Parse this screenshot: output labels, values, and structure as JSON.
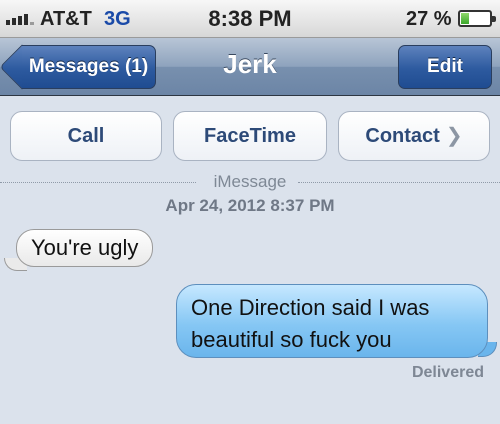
{
  "status_bar": {
    "carrier": "AT&T",
    "network": "3G",
    "time": "8:38 PM",
    "battery_percent": "27 %",
    "battery_level": 0.27,
    "signal_bars": 4
  },
  "nav": {
    "back_label": "Messages (1)",
    "title": "Jerk",
    "edit_label": "Edit"
  },
  "actions": {
    "call": "Call",
    "facetime": "FaceTime",
    "contact": "Contact"
  },
  "conversation": {
    "service_label": "iMessage",
    "timestamp": "Apr 24, 2012 8:37 PM",
    "messages": [
      {
        "direction": "incoming",
        "text": "You're ugly"
      },
      {
        "direction": "outgoing",
        "text": "One Direction said I was beautiful so fuck you"
      }
    ],
    "status": "Delivered"
  },
  "colors": {
    "nav_bar": "#7f96b4",
    "button_blue": "#2d5a9f",
    "outgoing_bubble": "#86c7f4",
    "incoming_bubble": "#f4f4f4",
    "background": "#dbe2ec"
  }
}
